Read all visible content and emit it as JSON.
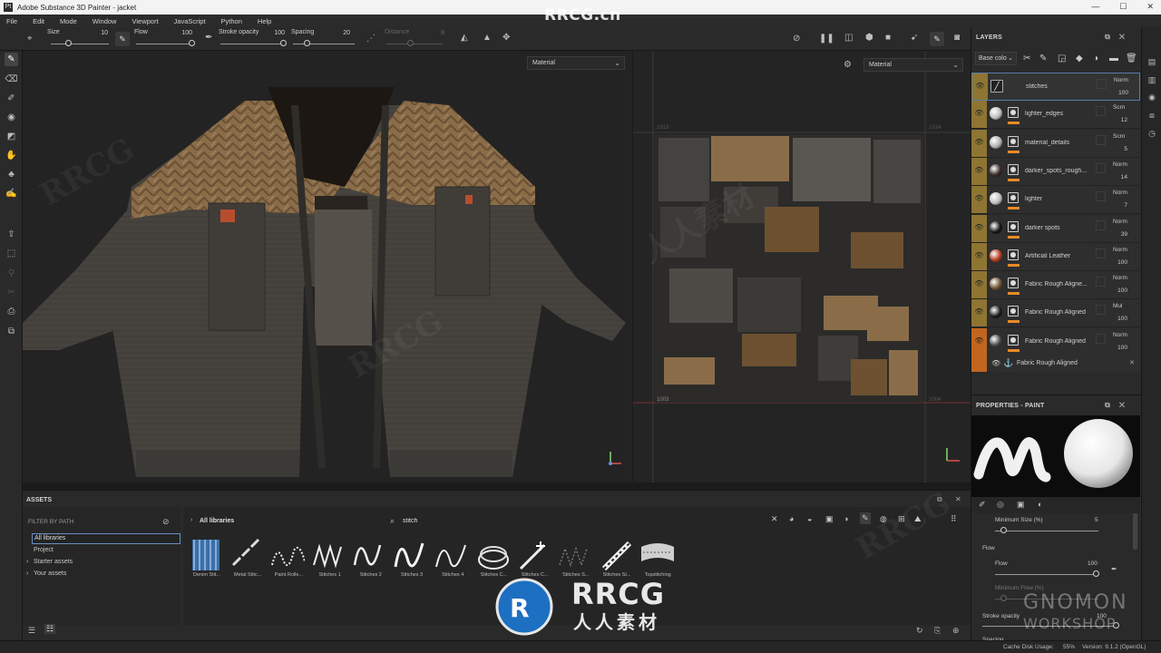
{
  "window": {
    "app_icon": "Pt",
    "title": "Adobe Substance 3D Painter - jacket",
    "controls": [
      "—",
      "☐",
      "✕"
    ]
  },
  "menu": [
    "File",
    "Edit",
    "Mode",
    "Window",
    "Viewport",
    "JavaScript",
    "Python",
    "Help"
  ],
  "toolbar": {
    "size": {
      "label": "Size",
      "value": "10",
      "level": 0.15
    },
    "flow": {
      "label": "Flow",
      "value": "100",
      "level": 1.0
    },
    "stroke_opacity": {
      "label": "Stroke opacity",
      "value": "100",
      "level": 1.0
    },
    "spacing": {
      "label": "Spacing",
      "value": "20",
      "level": 0.2
    },
    "distance": {
      "label": "Distance",
      "value": "8",
      "level": 0.5
    }
  },
  "viewport3d": {
    "mode": "Material"
  },
  "viewport2d": {
    "mode": "Material",
    "udims": [
      "1013",
      "1014",
      "1003",
      "1004"
    ]
  },
  "watermark": {
    "top": "RRCG.cn",
    "brand": "RRCG",
    "brand_sub": "人人素材",
    "gnomon": "GNOMON",
    "gnomon_sub": "WORKSHOP"
  },
  "layers": {
    "title": "LAYERS",
    "blend_mode": "Base colo",
    "items": [
      {
        "name": "stitches",
        "blend": "Norm",
        "opacity": "100",
        "thumb": "#c8c8c8",
        "type": "paint"
      },
      {
        "name": "lighter_edges",
        "blend": "Scrn",
        "opacity": "12",
        "thumb": "#bdbdbd"
      },
      {
        "name": "material_details",
        "blend": "Scrn",
        "opacity": "5",
        "thumb": "#b0b0b0"
      },
      {
        "name": "darker_spots_rough...",
        "blend": "Norm",
        "opacity": "14",
        "thumb": "#3a2a26"
      },
      {
        "name": "lighter",
        "blend": "Norm",
        "opacity": "7",
        "thumb": "#bdbdbd"
      },
      {
        "name": "darker spots",
        "blend": "Norm",
        "opacity": "39",
        "thumb": "#141414"
      },
      {
        "name": "Artificial Leather",
        "blend": "Norm",
        "opacity": "100",
        "thumb": "#b33a1e"
      },
      {
        "name": "Fabric Rough Aligne...",
        "blend": "Norm",
        "opacity": "100",
        "thumb": "#6d5130"
      },
      {
        "name": "Fabric Rough Aligned",
        "blend": "Mul",
        "opacity": "100",
        "thumb": "#1a1a1a"
      },
      {
        "name": "Fabric Rough Aligned",
        "blend": "Norm",
        "opacity": "100",
        "thumb": "#444444"
      }
    ],
    "anchor_layer": "Fabric Rough Aligned"
  },
  "properties": {
    "title": "PROPERTIES - PAINT",
    "min_size": {
      "label": "Minimum Size (%)",
      "value": "5",
      "level": 0.05
    },
    "section_flow": "Flow",
    "flow": {
      "label": "Flow",
      "value": "100",
      "level": 1.0
    },
    "min_flow": {
      "label": "Minimum Flow (%)",
      "value": ""
    },
    "stroke_opacity": {
      "label": "Stroke opacity",
      "value": "100",
      "level": 1.0
    },
    "spacing": {
      "label": "Spacing"
    }
  },
  "assets": {
    "title": "ASSETS",
    "filter_label": "FILTER BY PATH",
    "tree": [
      "All libraries",
      "Project",
      "Starter assets",
      "Your assets"
    ],
    "breadcrumb": "All libraries",
    "search": "stitch",
    "items": [
      {
        "label": "Denim Stit..."
      },
      {
        "label": "Metal Stitc..."
      },
      {
        "label": "Paint Rolle..."
      },
      {
        "label": "Stitches 1"
      },
      {
        "label": "Stitches 2"
      },
      {
        "label": "Stitches 3"
      },
      {
        "label": "Stitches 4"
      },
      {
        "label": "Stitches C..."
      },
      {
        "label": "Stitches C..."
      },
      {
        "label": "Stitches S..."
      },
      {
        "label": "Stitches St..."
      },
      {
        "label": "Topstitching"
      }
    ]
  },
  "status": {
    "cache_label": "Cache Disk Usage:",
    "cache_value": "55%",
    "version": "Version: 9.1.2 (OpenGL)"
  }
}
